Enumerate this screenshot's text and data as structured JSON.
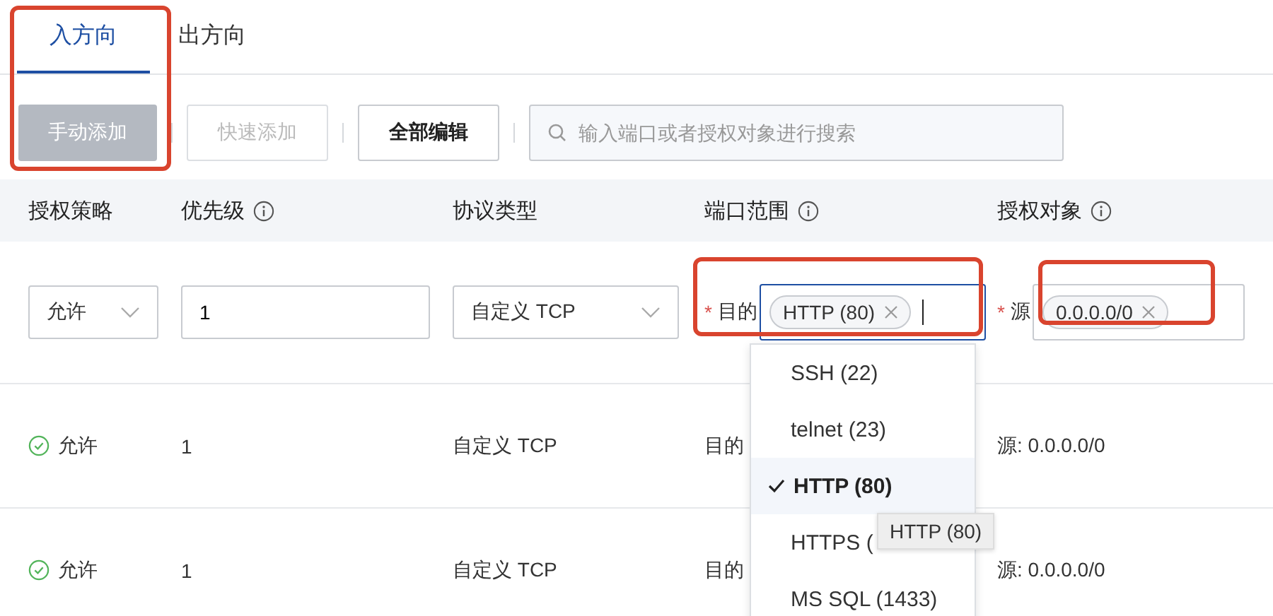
{
  "tabs": [
    {
      "label": "入方向",
      "selected": true
    },
    {
      "label": "出方向",
      "selected": false
    }
  ],
  "toolbar": {
    "buttons": [
      {
        "label": "手动添加",
        "disabled": true,
        "kind": "primary"
      },
      {
        "label": "快速添加",
        "disabled": true,
        "kind": "default"
      },
      {
        "label": "全部编辑",
        "disabled": false,
        "kind": "default"
      }
    ],
    "search": {
      "placeholder": "输入端口或者授权对象进行搜索"
    }
  },
  "table": {
    "columns": [
      {
        "label": "授权策略",
        "info": false
      },
      {
        "label": "优先级",
        "info": true
      },
      {
        "label": "协议类型",
        "info": false
      },
      {
        "label": "端口范围",
        "info": true
      },
      {
        "label": "授权对象",
        "info": true
      }
    ],
    "edit_row": {
      "policy": "允许",
      "priority": "1",
      "protocol": "自定义 TCP",
      "required_mark": "*",
      "port_label": "目的",
      "port_tags": [
        "HTTP (80)"
      ],
      "source_label": "源",
      "source_tags": [
        "0.0.0.0/0"
      ]
    },
    "rows": [
      {
        "policy": "允许",
        "priority": "1",
        "protocol": "自定义 TCP",
        "port": "目的",
        "source": "源: 0.0.0.0/0"
      },
      {
        "policy": "允许",
        "priority": "1",
        "protocol": "自定义 TCP",
        "port": "目的",
        "source": "源: 0.0.0.0/0"
      }
    ]
  },
  "dropdown": {
    "options": [
      {
        "label": "SSH (22)",
        "selected": false
      },
      {
        "label": "telnet (23)",
        "selected": false
      },
      {
        "label": "HTTP (80)",
        "selected": true
      },
      {
        "label": "HTTPS (",
        "selected": false
      },
      {
        "label": "MS SQL (1433)",
        "selected": false
      }
    ]
  },
  "tooltip": "HTTP (80)"
}
